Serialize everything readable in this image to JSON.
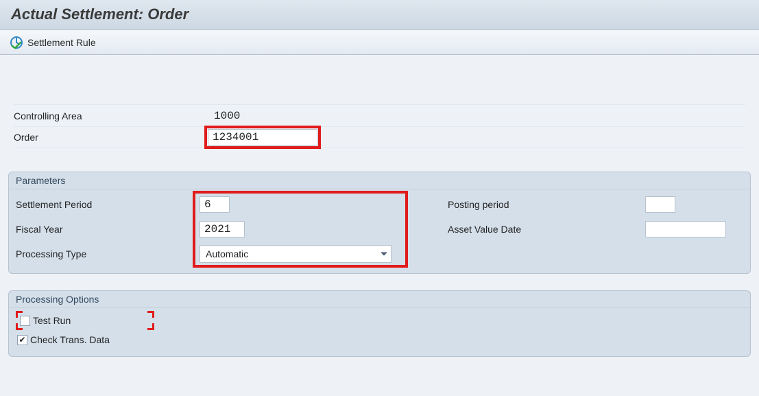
{
  "title": "Actual Settlement: Order",
  "toolbar": {
    "settlement_rule_label": "Settlement Rule"
  },
  "top": {
    "controlling_area_label": "Controlling Area",
    "controlling_area_value": "1000",
    "order_label": "Order",
    "order_value": "1234001"
  },
  "parameters": {
    "title": "Parameters",
    "settlement_period_label": "Settlement Period",
    "settlement_period_value": "6",
    "fiscal_year_label": "Fiscal Year",
    "fiscal_year_value": "2021",
    "processing_type_label": "Processing Type",
    "processing_type_value": "Automatic",
    "posting_period_label": "Posting period",
    "posting_period_value": "",
    "asset_value_date_label": "Asset Value Date",
    "asset_value_date_value": ""
  },
  "processing_options": {
    "title": "Processing Options",
    "test_run_label": "Test Run",
    "test_run_checked": false,
    "check_trans_data_label": "Check Trans. Data",
    "check_trans_data_checked": true
  }
}
